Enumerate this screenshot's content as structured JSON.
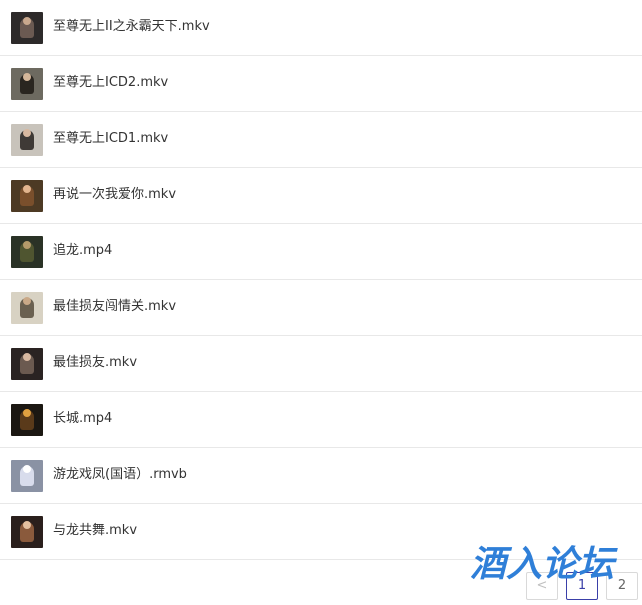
{
  "files": [
    {
      "name": "至尊无上II之永霸天下.mkv",
      "thumb_colors": [
        "#2d2a2a",
        "#6b5a52",
        "#c9a88d"
      ]
    },
    {
      "name": "至尊无上ICD2.mkv",
      "thumb_colors": [
        "#6d6a60",
        "#2a2620",
        "#d4b79a"
      ]
    },
    {
      "name": "至尊无上ICD1.mkv",
      "thumb_colors": [
        "#c8c3bb",
        "#3f3a36",
        "#d9b9a0"
      ]
    },
    {
      "name": "再说一次我爱你.mkv",
      "thumb_colors": [
        "#4d3a24",
        "#7a4f2c",
        "#e2b48e"
      ]
    },
    {
      "name": "追龙.mp4",
      "thumb_colors": [
        "#2a3226",
        "#4f5530",
        "#b49a6a"
      ]
    },
    {
      "name": "最佳损友闯情关.mkv",
      "thumb_colors": [
        "#d8d2c3",
        "#6a6050",
        "#caa988"
      ]
    },
    {
      "name": "最佳损友.mkv",
      "thumb_colors": [
        "#2a2322",
        "#6b5a50",
        "#d8b8a0"
      ]
    },
    {
      "name": "长城.mp4",
      "thumb_colors": [
        "#1b1712",
        "#5a3a1a",
        "#e0a040"
      ]
    },
    {
      "name": "游龙戏凤(国语）.rmvb",
      "thumb_colors": [
        "#8a92a4",
        "#d8dcec",
        "#ffffff"
      ]
    },
    {
      "name": "与龙共舞.mkv",
      "thumb_colors": [
        "#2a1f1c",
        "#8a5a3c",
        "#e4c0a0"
      ]
    }
  ],
  "pagination": {
    "prev_label": "<",
    "pages": [
      "1",
      "2"
    ],
    "active_page": "1"
  },
  "watermark": {
    "text": "酒入论坛",
    "color": "#2f7fd8"
  }
}
